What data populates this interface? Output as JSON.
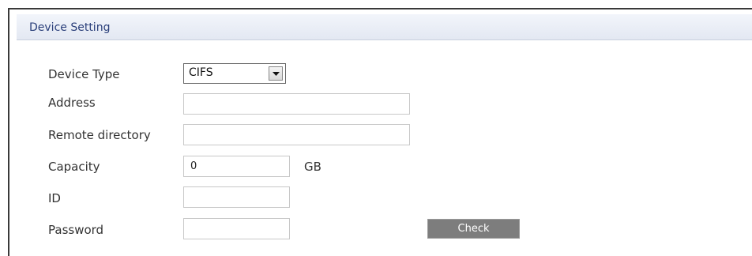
{
  "panel": {
    "title": "Device Setting"
  },
  "form": {
    "device_type": {
      "label": "Device Type",
      "value": "CIFS"
    },
    "address": {
      "label": "Address",
      "value": ""
    },
    "remote_directory": {
      "label": "Remote directory",
      "value": ""
    },
    "capacity": {
      "label": "Capacity",
      "value": "0",
      "unit": "GB"
    },
    "id": {
      "label": "ID",
      "value": ""
    },
    "password": {
      "label": "Password",
      "value": ""
    },
    "check_label": "Check"
  },
  "icons": {
    "dropdown": "chevron-down-icon"
  },
  "colors": {
    "header_text": "#2a3f7a",
    "button_bg": "#7d7d7d"
  }
}
